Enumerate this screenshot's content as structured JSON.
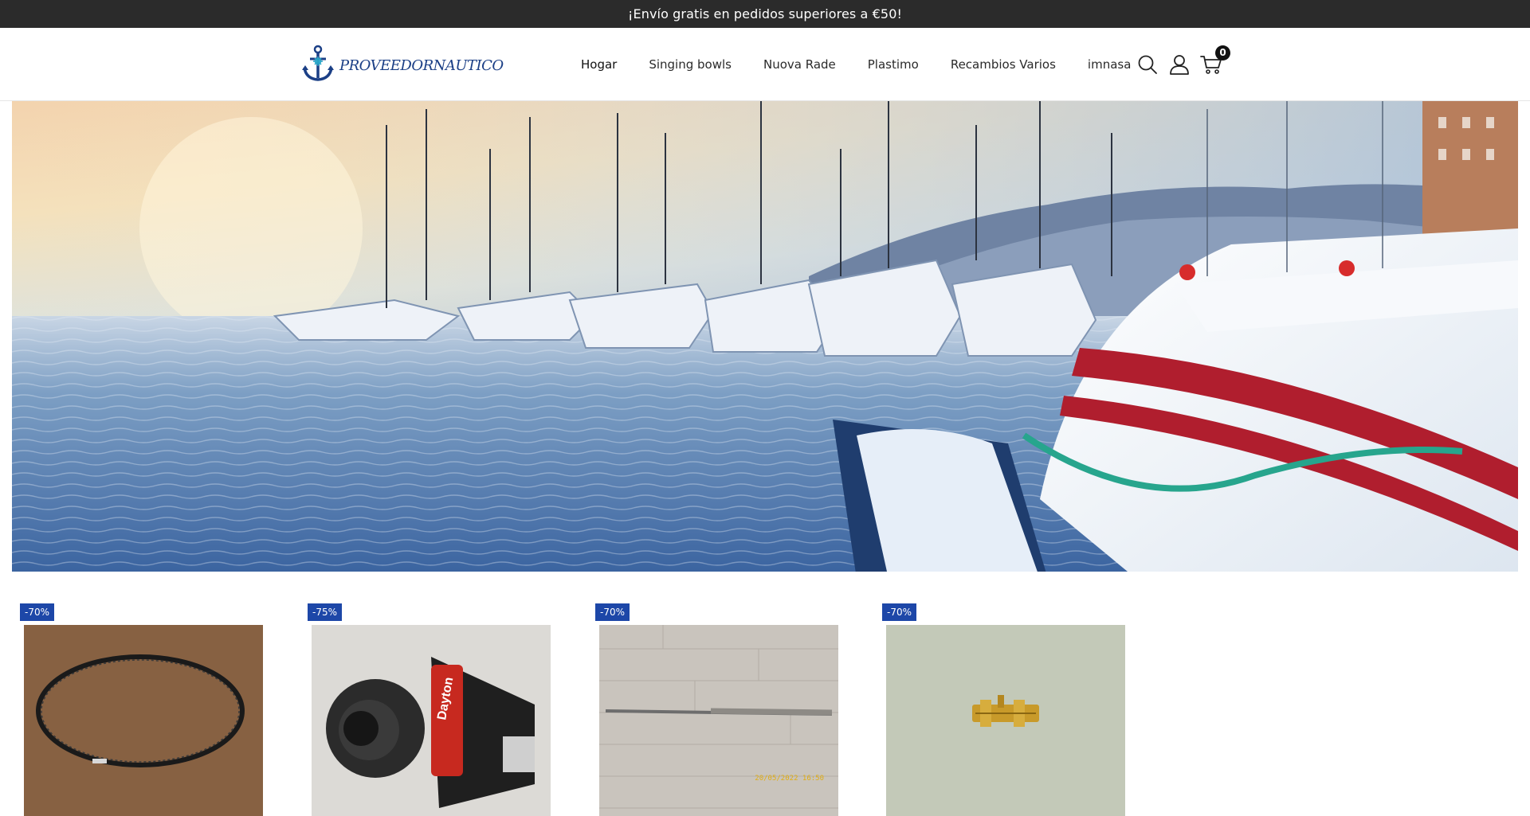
{
  "announcement": "¡Envío gratis en pedidos superiores a €50!",
  "brand": {
    "name": "PROVEEDORNAUTICO",
    "color": "#1b3f86"
  },
  "nav": [
    {
      "label": "Hogar",
      "active": true
    },
    {
      "label": "Singing bowls"
    },
    {
      "label": "Nuova Rade"
    },
    {
      "label": "Plastimo"
    },
    {
      "label": "Recambios Varios"
    },
    {
      "label": "imnasa"
    }
  ],
  "header_icons": [
    "search-icon",
    "user-icon",
    "cart-icon"
  ],
  "cart": {
    "count": "0"
  },
  "hero": {
    "scene": "snowy-marina-image"
  },
  "products": [
    {
      "discount": "-70%",
      "image": "v-belt-photo"
    },
    {
      "discount": "-75%",
      "image": "dayton-pump-photo"
    },
    {
      "discount": "-70%",
      "image": "stainless-rod-photo",
      "stamp": "20/05/2022 16:50"
    },
    {
      "discount": "-70%",
      "image": "brass-latch-photo"
    }
  ],
  "colors": {
    "topbar": "#2b2b2b",
    "badge": "#1d47a8"
  }
}
